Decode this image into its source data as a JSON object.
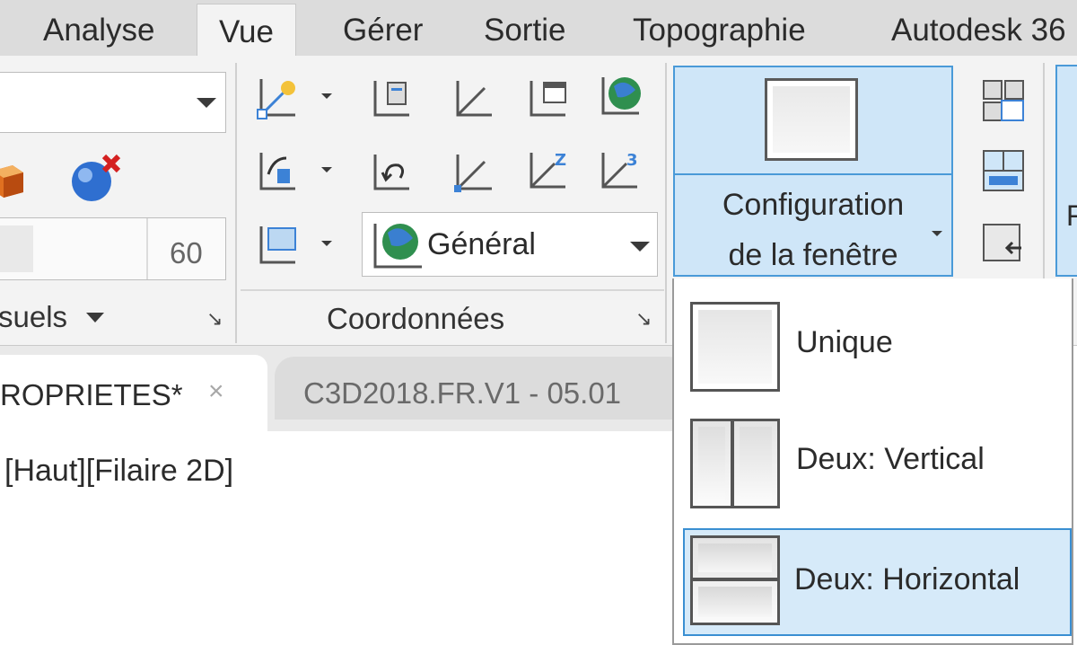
{
  "ribbon_tabs": [
    "Analyse",
    "Vue",
    "Gérer",
    "Sortie",
    "Topographie",
    "Autodesk 36"
  ],
  "active_tab": "Vue",
  "panels": {
    "visual_styles": {
      "title": "suels",
      "value_field": "60"
    },
    "coordinates": {
      "title": "Coordonnées",
      "ucs_dropdown": "Général"
    }
  },
  "window_config": {
    "label_line1": "Configuration",
    "label_line2": "de la fenêtre"
  },
  "right_partial_label": "F",
  "document_tabs": [
    {
      "title": "ROPRIETES*",
      "close": "×"
    },
    {
      "title": "C3D2018.FR.V1 - 05.01"
    }
  ],
  "viewport_label": "[Haut][Filaire 2D]",
  "window_config_menu": [
    {
      "label": "Unique",
      "icon": "single-viewport-icon",
      "selected": false
    },
    {
      "label": "Deux: Vertical",
      "icon": "two-vertical-viewports-icon",
      "selected": false
    },
    {
      "label": "Deux: Horizontal",
      "icon": "two-horizontal-viewports-icon",
      "selected": true
    }
  ],
  "colors": {
    "accent_blue": "#4a9ad8",
    "selected_bg": "#d6eaf9",
    "ribbon_bg": "#f3f3f3"
  }
}
